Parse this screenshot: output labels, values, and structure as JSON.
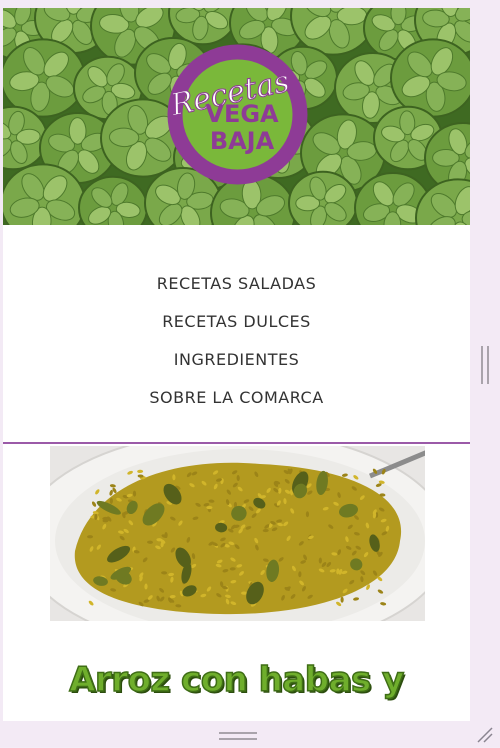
{
  "logo": {
    "script_text": "Recetas",
    "line1": "VEGA",
    "line2": "BAJA",
    "colors": {
      "ring": "#8e3b96",
      "fill": "#7ab83a",
      "text": "#8e3b96",
      "script": "#ffffff"
    }
  },
  "nav": {
    "items": [
      {
        "label": "RECETAS SALADAS"
      },
      {
        "label": "RECETAS DULCES"
      },
      {
        "label": "INGREDIENTES"
      },
      {
        "label": "SOBRE LA COMARCA"
      }
    ]
  },
  "post": {
    "title": "Arroz con habas y"
  },
  "icons": {
    "vertical_scroll": "scrollbar-grip-icon",
    "horizontal_scroll": "horizontal-grip-icon",
    "resize": "resize-corner-icon"
  },
  "colors": {
    "accent_purple": "#9b5aa8",
    "title_green": "#6fae2c",
    "frame_bg": "#f3eaf5"
  }
}
